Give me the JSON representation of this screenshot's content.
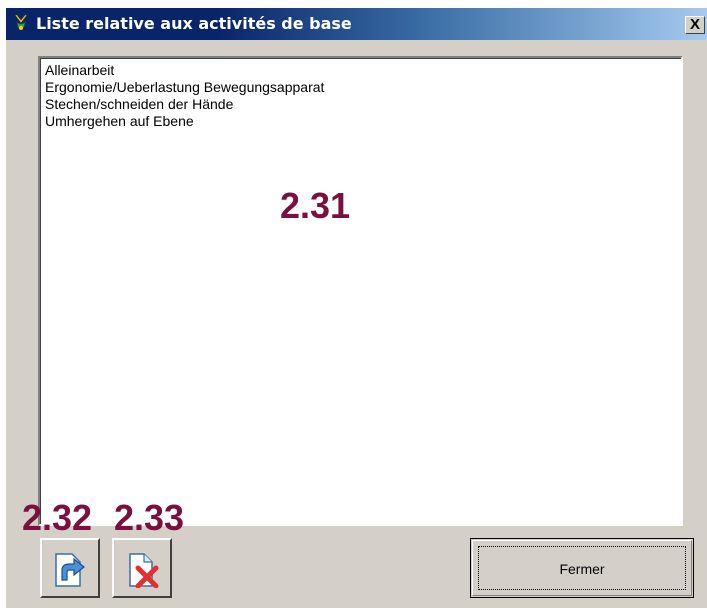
{
  "window": {
    "title": "Liste relative aux activités de base",
    "close_glyph": "X"
  },
  "list": {
    "items": [
      "Alleinarbeit",
      "Ergonomie/Ueberlastung Bewegungsapparat",
      "Stechen/schneiden der Hände",
      "Umhergehen auf Ebene"
    ]
  },
  "callouts": {
    "list": "2.31",
    "export": "2.32",
    "delete": "2.33"
  },
  "buttons": {
    "export_icon": "share-arrow-icon",
    "delete_icon": "delete-document-icon",
    "close_label": "Fermer"
  },
  "colors": {
    "titlebar_start": "#0a246a",
    "titlebar_end": "#a6caf0",
    "callout": "#7a1040",
    "delete_x": "#e03030"
  }
}
